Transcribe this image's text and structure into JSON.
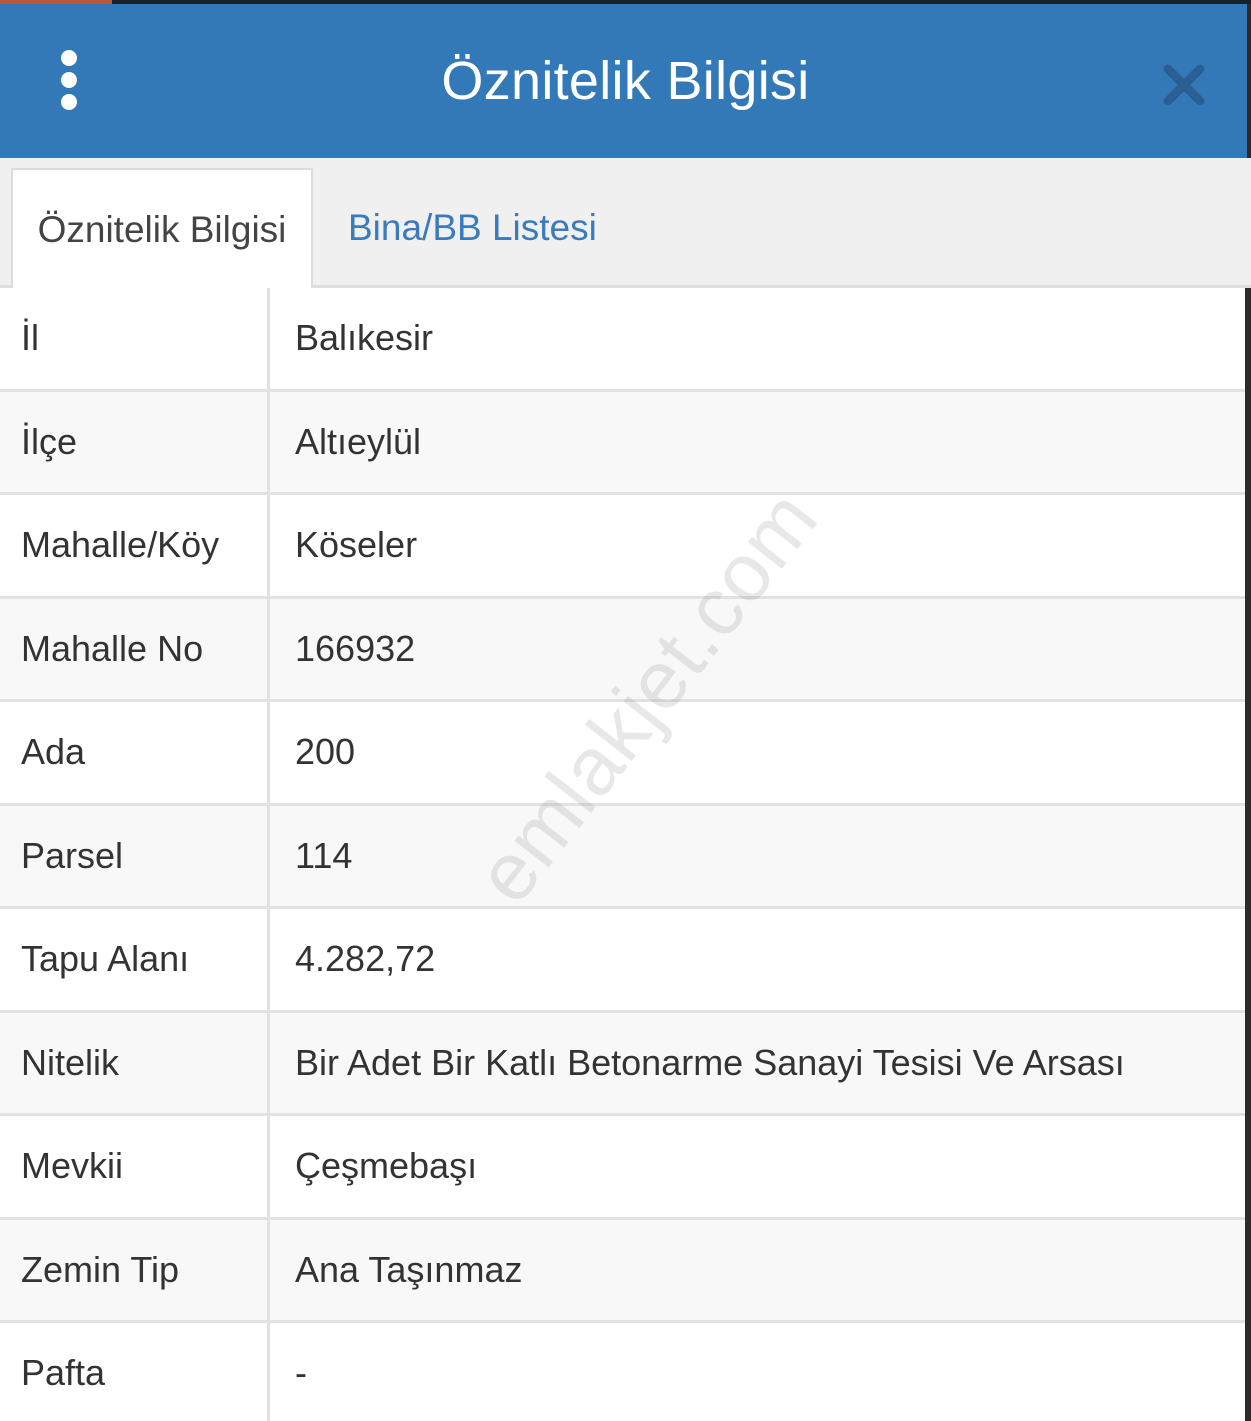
{
  "header": {
    "title": "Öznitelik Bilgisi",
    "menu_icon": "kebab-menu-icon",
    "close_icon": "close-icon"
  },
  "tabs": [
    {
      "label": "Öznitelik Bilgisi",
      "active": true
    },
    {
      "label": "Bina/BB Listesi",
      "active": false
    }
  ],
  "rows": [
    {
      "label": "İl",
      "value": "Balıkesir"
    },
    {
      "label": "İlçe",
      "value": "Altıeylül"
    },
    {
      "label": "Mahalle/Köy",
      "value": "Köseler"
    },
    {
      "label": "Mahalle No",
      "value": "166932"
    },
    {
      "label": "Ada",
      "value": "200"
    },
    {
      "label": "Parsel",
      "value": "114"
    },
    {
      "label": "Tapu Alanı",
      "value": "4.282,72"
    },
    {
      "label": "Nitelik",
      "value": "Bir Adet Bir Katlı Betonarme Sanayi Tesisi Ve Arsası"
    },
    {
      "label": "Mevkii",
      "value": "Çeşmebaşı"
    },
    {
      "label": "Zemin Tip",
      "value": "Ana Taşınmaz"
    },
    {
      "label": "Pafta",
      "value": "-"
    }
  ],
  "watermark": "emlakjet.com",
  "colors": {
    "header_bg": "#3479b7",
    "tab_link": "#3a7bbd",
    "close_icon": "#2a5f93"
  }
}
